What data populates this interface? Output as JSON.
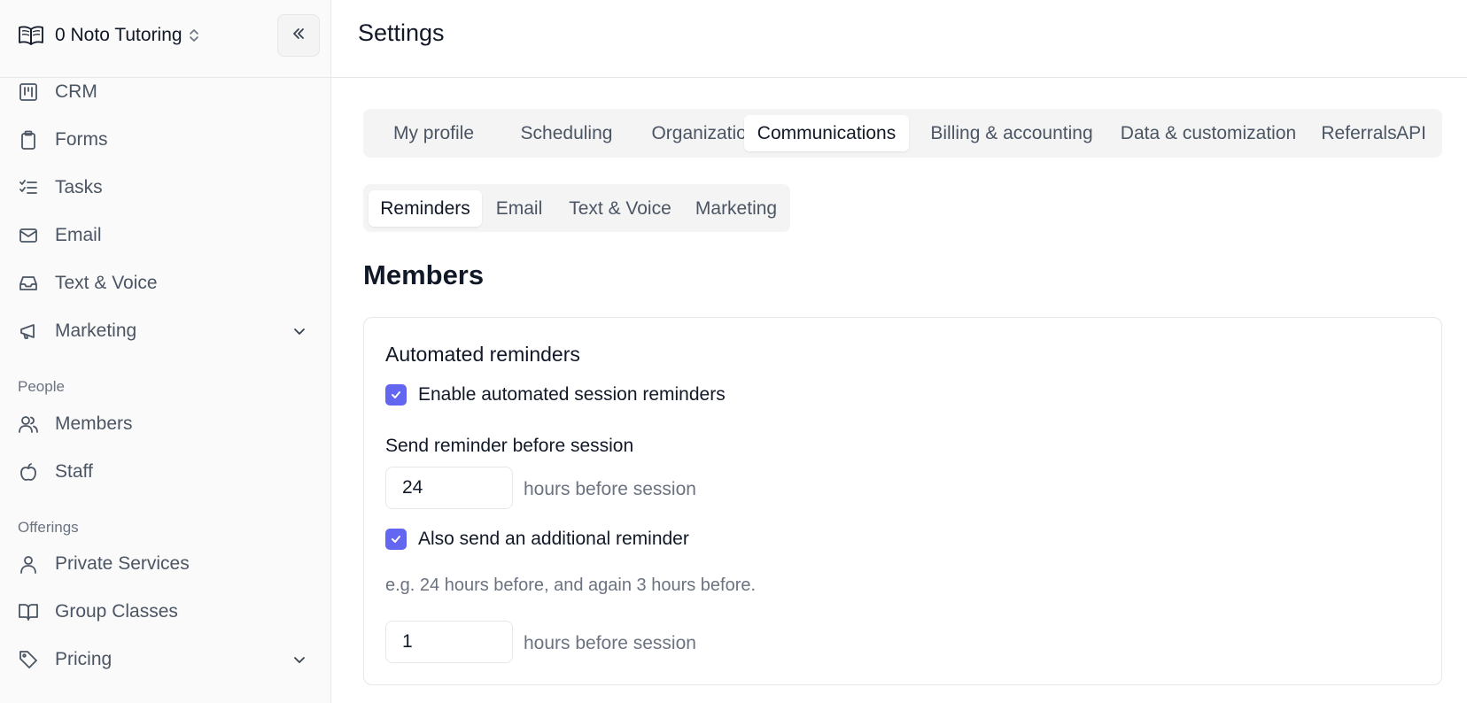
{
  "sidebar": {
    "org_name": "0 Noto Tutoring",
    "items": [
      {
        "label": "CRM",
        "icon": "kanban-icon"
      },
      {
        "label": "Forms",
        "icon": "clipboard-icon"
      },
      {
        "label": "Tasks",
        "icon": "list-checks-icon"
      },
      {
        "label": "Email",
        "icon": "mail-icon"
      },
      {
        "label": "Text & Voice",
        "icon": "inbox-icon"
      },
      {
        "label": "Marketing",
        "icon": "megaphone-icon"
      }
    ],
    "people_label": "People",
    "people_items": [
      {
        "label": "Members",
        "icon": "users-icon"
      },
      {
        "label": "Staff",
        "icon": "apple-icon"
      }
    ],
    "offerings_label": "Offerings",
    "offerings_items": [
      {
        "label": "Private Services",
        "icon": "user-icon"
      },
      {
        "label": "Group Classes",
        "icon": "book-open-icon"
      },
      {
        "label": "Pricing",
        "icon": "tag-icon"
      }
    ]
  },
  "header": {
    "title": "Settings"
  },
  "tabs": [
    "My profile",
    "Scheduling",
    "Organization",
    "Communications",
    "Billing & accounting",
    "Data & customization",
    "Referrals",
    "API"
  ],
  "active_tab": "Communications",
  "subtabs": [
    "Reminders",
    "Email",
    "Text & Voice",
    "Marketing"
  ],
  "active_subtab": "Reminders",
  "section_title": "Members",
  "card": {
    "title": "Automated reminders",
    "enable_label": "Enable automated session reminders",
    "enable_checked": true,
    "send_before_label": "Send reminder before session",
    "hours_value": "24",
    "hours_suffix": "hours before session",
    "additional_label": "Also send an additional reminder",
    "additional_checked": true,
    "hint": "e.g. 24 hours before, and again 3 hours before.",
    "additional_hours_value": "1",
    "additional_suffix": "hours before session"
  },
  "colors": {
    "accent": "#6366f1",
    "sidebar_bg": "#fafafa",
    "border": "#e5e7eb",
    "muted_text": "#4b5563"
  }
}
